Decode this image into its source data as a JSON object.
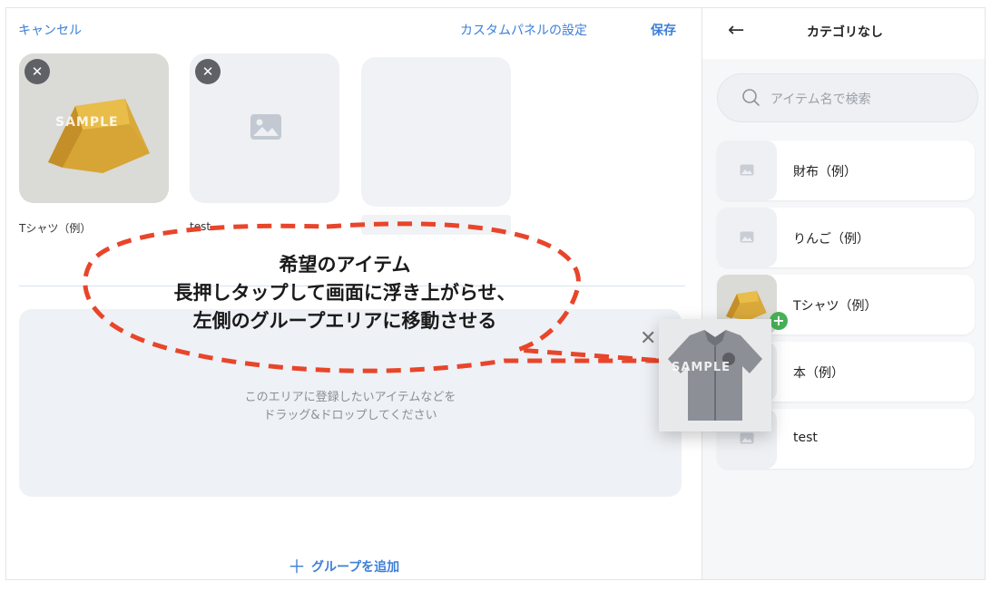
{
  "left_panel": {
    "cancel_label": "キャンセル",
    "panel_settings_label": "カスタムパネルの設定",
    "save_label": "保存",
    "tiles": [
      {
        "label": "Tシャツ（例）",
        "image": "yellow-bag-photo",
        "watermark": "SAMPLE"
      },
      {
        "label": "test",
        "image": "image-placeholder-icon"
      },
      {
        "label": "",
        "image": "empty"
      }
    ],
    "dropzone": {
      "line1": "このエリアに登録したいアイテムなどを",
      "line2": "ドラッグ&ドロップしてください"
    },
    "add_group_label": "グループを追加"
  },
  "right_panel": {
    "title": "カテゴリなし",
    "search_placeholder": "アイテム名で検索",
    "items": [
      {
        "name": "財布（例）",
        "thumb": "image-placeholder-icon"
      },
      {
        "name": "りんご（例）",
        "thumb": "image-placeholder-icon"
      },
      {
        "name": "Tシャツ（例）",
        "thumb": "yellow-bag-photo"
      },
      {
        "name": "本（例）",
        "thumb": "image-placeholder-icon"
      },
      {
        "name": "test",
        "thumb": "image-placeholder-icon"
      }
    ]
  },
  "drag_ghost": {
    "watermark": "SAMPLE",
    "image": "gray-shirt-photo"
  },
  "annotation": {
    "line1": "希望のアイテム",
    "line2": "長押しタップして画面に浮き上がらせ、",
    "line3": "左側のグループエリアに移動させる",
    "color": "#e8452a"
  },
  "colors": {
    "accent": "#3d7fd8",
    "add_badge": "#46b157"
  }
}
